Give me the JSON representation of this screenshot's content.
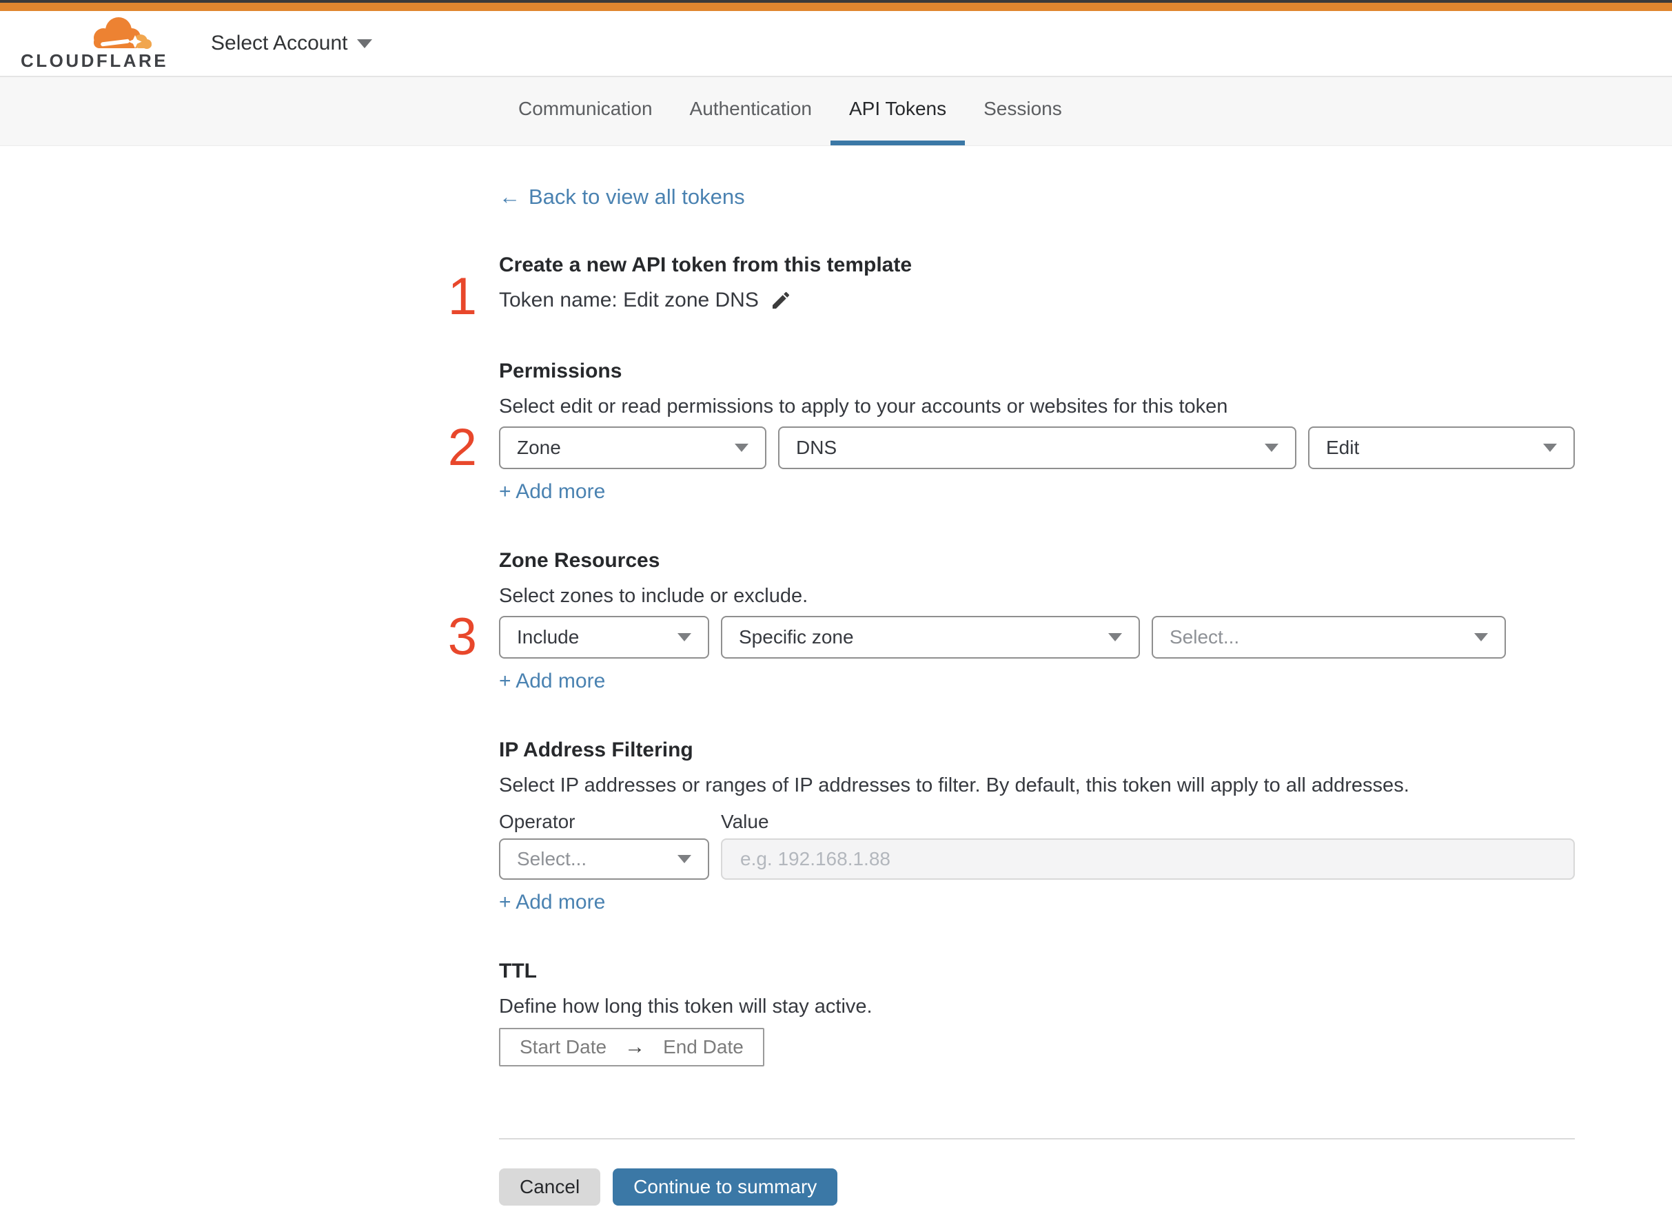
{
  "header": {
    "logo_text": "CLOUDFLARE",
    "account_selector": {
      "label": "Select Account"
    }
  },
  "tabs": {
    "items": [
      {
        "label": "Communication",
        "active": false
      },
      {
        "label": "Authentication",
        "active": false
      },
      {
        "label": "API Tokens",
        "active": true
      },
      {
        "label": "Sessions",
        "active": false
      }
    ]
  },
  "back_link": {
    "arrow": "←",
    "label": "Back to view all tokens"
  },
  "token_form": {
    "annotation": "1",
    "title": "Create a new API token from this template",
    "token_name_line": "Token name: Edit zone DNS"
  },
  "permissions": {
    "annotation": "2",
    "heading": "Permissions",
    "description": "Select edit or read permissions to apply to your accounts or websites for this token",
    "dropdowns": [
      {
        "value": "Zone"
      },
      {
        "value": "DNS"
      },
      {
        "value": "Edit"
      }
    ],
    "add_more": "+ Add more"
  },
  "zone_resources": {
    "annotation": "3",
    "heading": "Zone Resources",
    "description": "Select zones to include or exclude.",
    "dropdowns": [
      {
        "value": "Include"
      },
      {
        "value": "Specific zone"
      },
      {
        "value": "Select..."
      }
    ],
    "add_more": "+ Add more"
  },
  "ip_filtering": {
    "heading": "IP Address Filtering",
    "description": "Select IP addresses or ranges of IP addresses to filter. By default, this token will apply to all addresses.",
    "operator_label": "Operator",
    "value_label": "Value",
    "operator_placeholder": "Select...",
    "value_placeholder": "e.g. 192.168.1.88",
    "add_more": "+ Add more"
  },
  "ttl": {
    "heading": "TTL",
    "description": "Define how long this token will stay active.",
    "start_placeholder": "Start Date",
    "arrow": "→",
    "end_placeholder": "End Date"
  },
  "footer": {
    "cancel_label": "Cancel",
    "continue_label": "Continue to summary"
  },
  "colors": {
    "top_bar_orange": "#e0862f",
    "link_blue": "#4a82b1",
    "button_blue": "#3b78a6",
    "annotation_red": "#e8472b",
    "tabbar_bg": "#f7f7f7"
  }
}
